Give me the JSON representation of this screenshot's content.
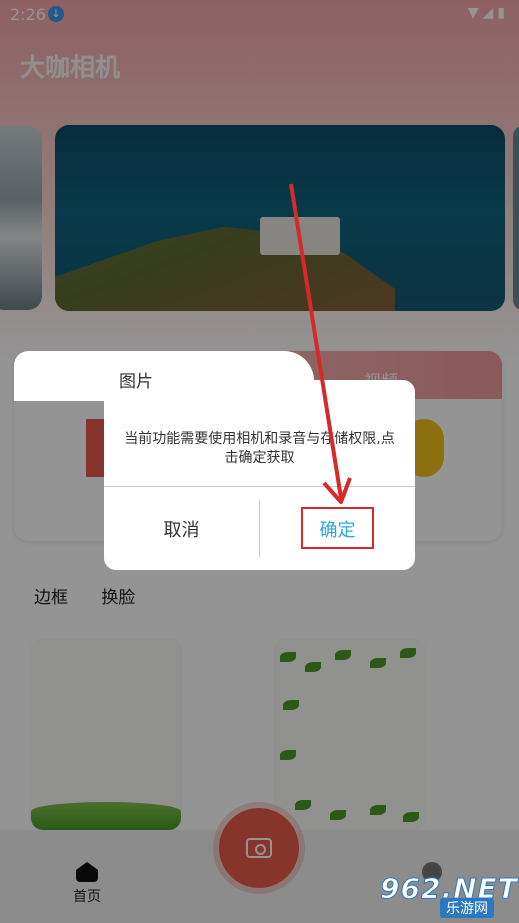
{
  "status_bar": {
    "time": "2:26",
    "download_icon": "download-icon",
    "right_icons": [
      "wifi-icon",
      "signal-icon",
      "battery-icon"
    ]
  },
  "app": {
    "title": "大咖相机"
  },
  "main_tabs": [
    {
      "label": "图片"
    },
    {
      "label": "视频"
    }
  ],
  "sub_tabs": [
    {
      "label": "边框"
    },
    {
      "label": "换脸"
    }
  ],
  "bottom_nav": {
    "home_label": "首页",
    "camera_icon": "camera-icon"
  },
  "dialog": {
    "message": "当前功能需要使用相机和录音与存储权限,点击确定获取",
    "cancel_label": "取消",
    "confirm_label": "确定"
  },
  "annotation_color": "#d42a2a",
  "accent_color": "#2aa8e0",
  "watermark": {
    "top": "962.NET",
    "bottom": "乐游网"
  }
}
